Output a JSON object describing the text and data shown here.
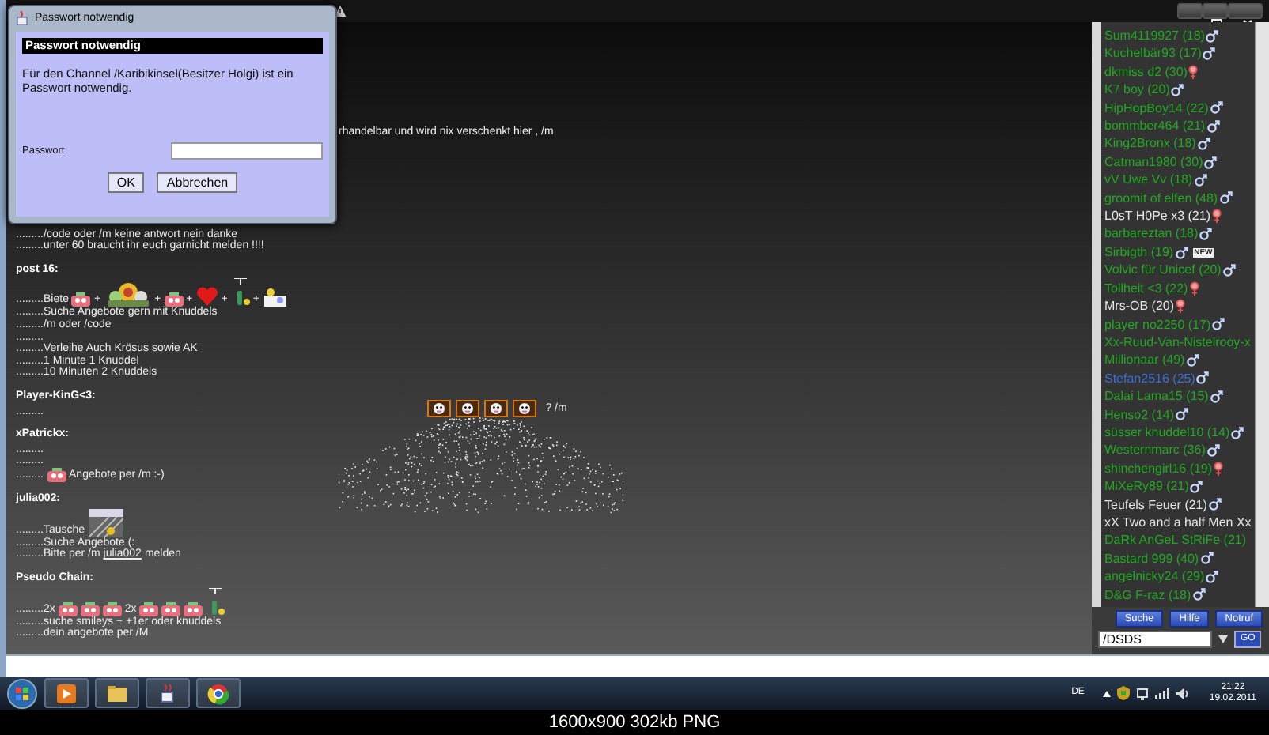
{
  "dialog": {
    "window_title": "Passwort notwendig",
    "header": "Passwort notwendig",
    "message": "Für den Channel /Karibikinsel(Besitzer Holgi) ist ein Passwort notwendig.",
    "field_label": "Passwort",
    "buttons": [
      "OK",
      "Abbrechen"
    ]
  },
  "chat": {
    "partial_line": "rhandelbar und wird nix verschenkt hier , /m",
    "lines": [
      {
        "kind": "text",
        "text": "........./code oder /m  keine antwort nein danke"
      },
      {
        "kind": "text",
        "text": ".........unter 60 braucht ihr euch garnicht melden !!!!"
      },
      {
        "kind": "author",
        "text": "post 16:"
      },
      {
        "kind": "mixed",
        "parts": [
          {
            "kind": "text",
            "text": ".........Biete"
          },
          {
            "kind": "sticker"
          },
          {
            "kind": "text",
            "text": "+"
          },
          {
            "kind": "bouquet"
          },
          {
            "kind": "text",
            "text": "+"
          },
          {
            "kind": "sticker"
          },
          {
            "kind": "text",
            "text": "+"
          },
          {
            "kind": "heart"
          },
          {
            "kind": "text",
            "text": "+"
          },
          {
            "kind": "bottle"
          },
          {
            "kind": "text",
            "text": "+"
          },
          {
            "kind": "cake"
          }
        ]
      },
      {
        "kind": "text",
        "text": ".........Suche Angebote gern mit Knuddels"
      },
      {
        "kind": "text",
        "text": "........./m oder /code"
      },
      {
        "kind": "text",
        "text": "........."
      },
      {
        "kind": "text",
        "text": ".........Verleihe Auch Krösus sowie AK"
      },
      {
        "kind": "text",
        "text": ".........1 Minute 1 Knuddel"
      },
      {
        "kind": "text",
        "text": ".........10 Minuten 2 Knuddels"
      },
      {
        "kind": "author",
        "text": "Player-KinG<3:"
      },
      {
        "kind": "text",
        "text": "........."
      },
      {
        "kind": "author",
        "text": "xPatrickx:"
      },
      {
        "kind": "text",
        "text": "........."
      },
      {
        "kind": "text",
        "text": "........."
      },
      {
        "kind": "mixed",
        "parts": [
          {
            "kind": "text",
            "text": "........."
          },
          {
            "kind": "sticker"
          },
          {
            "kind": "text",
            "text": "Angebote per /m :-)"
          }
        ]
      },
      {
        "kind": "author",
        "text": "julia002:"
      },
      {
        "kind": "mixed",
        "parts": [
          {
            "kind": "text",
            "text": ".........Tausche"
          },
          {
            "kind": "banner"
          }
        ]
      },
      {
        "kind": "text",
        "text": ".........Suche Angebote (:"
      },
      {
        "kind": "mixed",
        "parts": [
          {
            "kind": "text",
            "text": ".........Bitte per /m"
          },
          {
            "kind": "link",
            "text": "julia002"
          },
          {
            "kind": "text",
            "text": "melden"
          }
        ]
      },
      {
        "kind": "author",
        "text": "Pseudo Chain:"
      },
      {
        "kind": "mixed",
        "parts": [
          {
            "kind": "text",
            "text": ".........2x"
          },
          {
            "kind": "sticker"
          },
          {
            "kind": "sticker"
          },
          {
            "kind": "sticker"
          },
          {
            "kind": "text",
            "text": "2x"
          },
          {
            "kind": "sticker"
          },
          {
            "kind": "sticker"
          },
          {
            "kind": "sticker"
          },
          {
            "kind": "bottle"
          }
        ]
      },
      {
        "kind": "text",
        "text": ".........suche smileys ~ +1er oder knuddels"
      },
      {
        "kind": "text",
        "text": ".........dein angebote per /M"
      }
    ]
  },
  "center_post": {
    "stickers": [
      {
        "kind": "framed"
      },
      {
        "kind": "framed"
      },
      {
        "kind": "framed"
      },
      {
        "kind": "framed"
      }
    ],
    "text": "? /m"
  },
  "users": [
    {
      "name": "Sum4119927 (18)",
      "color": "#21a821",
      "female": false
    },
    {
      "name": "Kuchelbär93 (17)",
      "color": "#21a821",
      "female": false
    },
    {
      "name": "dkmiss d2 (30)",
      "color": "#21a821",
      "female": true
    },
    {
      "name": "K7 boy (20)",
      "color": "#21a821",
      "female": false
    },
    {
      "name": "HipHopBoy14 (22)",
      "color": "#21a821",
      "female": false
    },
    {
      "name": "bommber464 (21)",
      "color": "#21a821",
      "female": false
    },
    {
      "name": "King2Bronx (18)",
      "color": "#21a821",
      "female": false
    },
    {
      "name": "Catman1980 (30)",
      "color": "#21a821",
      "female": false
    },
    {
      "name": "vV Uwe Vv (18)",
      "color": "#21a821",
      "female": false
    },
    {
      "name": "groomit of elfen (48)",
      "color": "#21a821",
      "female": false
    },
    {
      "name": "L0sT H0Pe x3 (21)",
      "color": "#e6e6e6",
      "female": true
    },
    {
      "name": "barbareztan (18)",
      "color": "#21a821",
      "female": false
    },
    {
      "name": "Sirbigth (19)",
      "color": "#21a821",
      "female": false,
      "badge": "NEW"
    },
    {
      "name": "Volvic für Unicef (20)",
      "color": "#21a821",
      "female": false
    },
    {
      "name": "Tollheit <3 (22)",
      "color": "#21a821",
      "female": true
    },
    {
      "name": "Mrs-OB (20)",
      "color": "#e6e6e6",
      "female": true
    },
    {
      "name": "player no2250 (17)",
      "color": "#21a821",
      "female": false
    },
    {
      "name": "Xx-Ruud-Van-Nistelrooy-x",
      "color": "#21a821"
    },
    {
      "name": "Millionaar (49)",
      "color": "#21a821",
      "female": false
    },
    {
      "name": "Stefan2516 (25)",
      "color": "#3a6fd8",
      "female": false
    },
    {
      "name": "Dalai Lama15 (15)",
      "color": "#21a821",
      "female": false
    },
    {
      "name": "Henso2 (14)",
      "color": "#21a821",
      "female": false
    },
    {
      "name": "süsser knuddel10 (14)",
      "color": "#21a821",
      "female": false
    },
    {
      "name": "Westernmarc (36)",
      "color": "#21a821",
      "female": false
    },
    {
      "name": "shinchengirl16 (19)",
      "color": "#21a821",
      "female": true
    },
    {
      "name": "MiXeRy89 (21)",
      "color": "#21a821",
      "female": false
    },
    {
      "name": "Teufels Feuer (21)",
      "color": "#e6e6e6",
      "female": false
    },
    {
      "name": "xX Two and a half Men Xx",
      "color": "#e6e6e6"
    },
    {
      "name": "DaRk AnGeL StRiFe (21)",
      "color": "#21a821"
    },
    {
      "name": "Bastard 999 (40)",
      "color": "#21a821",
      "female": false
    },
    {
      "name": "angelnicky24 (29)",
      "color": "#21a821",
      "female": false
    },
    {
      "name": "D&G F-raz (18)",
      "color": "#21a821",
      "female": false
    }
  ],
  "panel_buttons": [
    "Suche",
    "Hilfe",
    "Notruf"
  ],
  "command": {
    "value": "/DSDS",
    "go_button": "GO"
  },
  "taskbar": {
    "language": "DE",
    "time": "21:22",
    "date": "19.02.2011"
  },
  "caption": "1600x900 302kb PNG"
}
